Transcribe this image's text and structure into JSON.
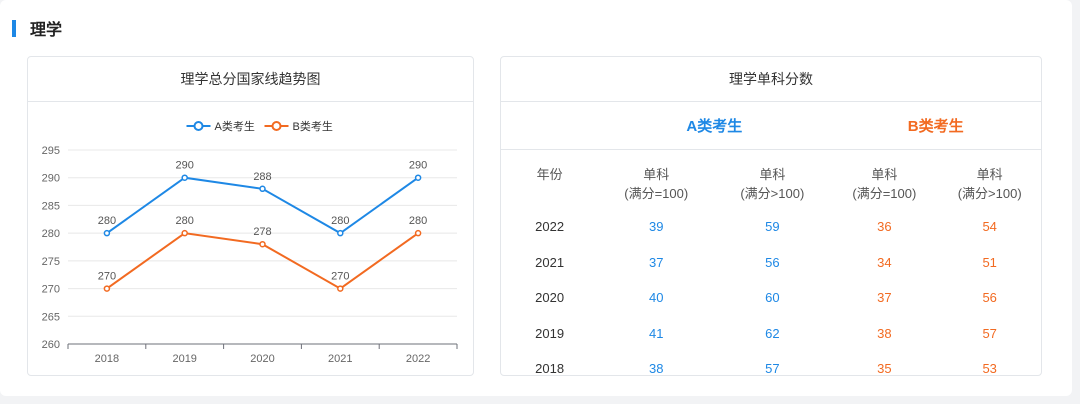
{
  "section": {
    "title": "理学"
  },
  "left_panel": {
    "title": "理学总分国家线趋势图"
  },
  "right_panel": {
    "title": "理学单科分数",
    "group_a": "A类考生",
    "group_b": "B类考生",
    "col_year": "年份",
    "col_single_a": "单科",
    "col_full_100": "(满分=100)",
    "col_full_gt100": "(满分>100)",
    "rows": [
      {
        "year": "2022",
        "a1": "39",
        "a2": "59",
        "b1": "36",
        "b2": "54"
      },
      {
        "year": "2021",
        "a1": "37",
        "a2": "56",
        "b1": "34",
        "b2": "51"
      },
      {
        "year": "2020",
        "a1": "40",
        "a2": "60",
        "b1": "37",
        "b2": "56"
      },
      {
        "year": "2019",
        "a1": "41",
        "a2": "62",
        "b1": "38",
        "b2": "57"
      },
      {
        "year": "2018",
        "a1": "38",
        "a2": "57",
        "b1": "35",
        "b2": "53"
      }
    ]
  },
  "colors": {
    "series_a": "#1e88e5",
    "series_b": "#f26a21"
  },
  "chart_data": {
    "type": "line",
    "categories": [
      "2018",
      "2019",
      "2020",
      "2021",
      "2022"
    ],
    "series": [
      {
        "name": "A类考生",
        "values": [
          280,
          290,
          288,
          280,
          290
        ]
      },
      {
        "name": "B类考生",
        "values": [
          270,
          280,
          278,
          270,
          280
        ]
      }
    ],
    "yticks": [
      260,
      265,
      270,
      275,
      280,
      285,
      290,
      295
    ],
    "ylim": [
      260,
      295
    ],
    "legend": "top-center",
    "grid": true
  }
}
